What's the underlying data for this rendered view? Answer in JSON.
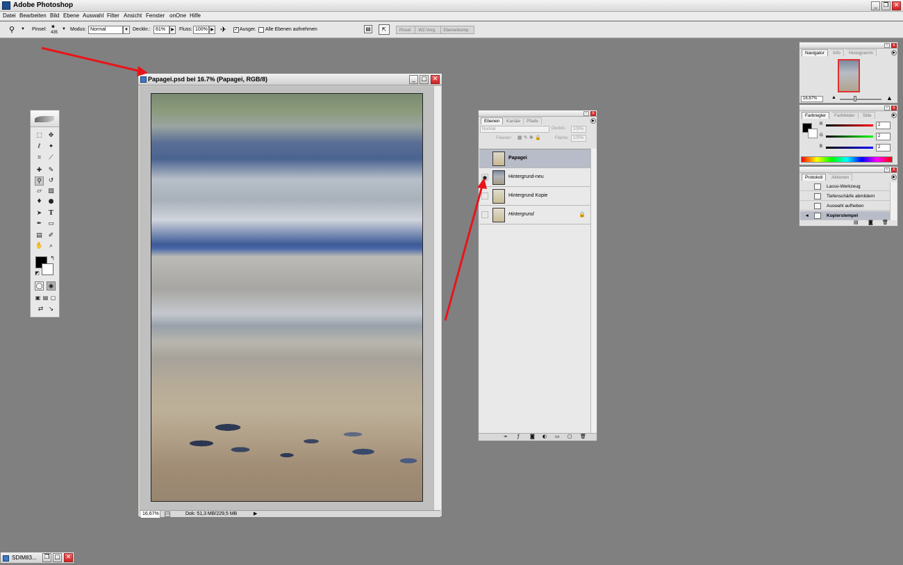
{
  "app": {
    "title": "Adobe Photoshop"
  },
  "menu": [
    "Datei",
    "Bearbeiten",
    "Bild",
    "Ebene",
    "Auswahl",
    "Filter",
    "Ansicht",
    "Fenster",
    "onOne",
    "Hilfe"
  ],
  "options": {
    "brush_label": "Pinsel:",
    "brush_size": "435",
    "mode_label": "Modus:",
    "mode_value": "Normal",
    "opacity_label": "Deckkr.:",
    "opacity_value": "61%",
    "flow_label": "Fluss:",
    "flow_value": "100%",
    "aligned_label": "Ausger.",
    "aligned_checked": true,
    "all_layers_label": "Alle Ebenen aufnehmen",
    "all_layers_checked": false,
    "wells": [
      "Pinsel",
      "WZ-Vorg.",
      "Ebenenkomp."
    ]
  },
  "document": {
    "title": "Papagei.psd bei 16.7% (Papagei, RGB/8)",
    "zoom": "16,67%",
    "doc_size": "Dok: 51,3 MB/229,5 MB"
  },
  "layers_panel": {
    "tabs": [
      "Ebenen",
      "Kanäle",
      "Pfade"
    ],
    "blend_mode": "Normal",
    "opacity_label": "Deckkr.:",
    "opacity_value": "100%",
    "lock_label": "Fixieren:",
    "fill_label": "Fläche:",
    "fill_value": "100%",
    "layers": [
      {
        "name": "Papagei",
        "selected": true,
        "visible": false,
        "locked": false
      },
      {
        "name": "Hintergrund-neu",
        "selected": false,
        "visible": true,
        "locked": false
      },
      {
        "name": "Hintergrund Kopie",
        "selected": false,
        "visible": false,
        "locked": false
      },
      {
        "name": "Hintergrund",
        "selected": false,
        "visible": false,
        "locked": true
      }
    ]
  },
  "navigator_panel": {
    "tabs": [
      "Navigator",
      "Info",
      "Histogramm"
    ],
    "zoom": "16,67%"
  },
  "color_panel": {
    "tabs": [
      "Farbregler",
      "Farbfelder",
      "Stile"
    ],
    "channels": [
      {
        "label": "R",
        "value": "2",
        "color": "#e02020"
      },
      {
        "label": "G",
        "value": "2",
        "color": "#20c020"
      },
      {
        "label": "B",
        "value": "2",
        "color": "#2030d0"
      }
    ]
  },
  "history_panel": {
    "tabs": [
      "Protokoll",
      "Aktionen"
    ],
    "items": [
      {
        "label": "Lasso-Werkzeug",
        "selected": false
      },
      {
        "label": "Tiefenschärfe abmildern",
        "selected": false
      },
      {
        "label": "Auswahl aufheben",
        "selected": false
      },
      {
        "label": "Kopierstempel",
        "selected": true
      }
    ]
  },
  "taskbar": {
    "minimized_title": "SDIM83..."
  },
  "colors": {
    "arrow": "#e8141a",
    "selection": "#b8bcc8"
  }
}
